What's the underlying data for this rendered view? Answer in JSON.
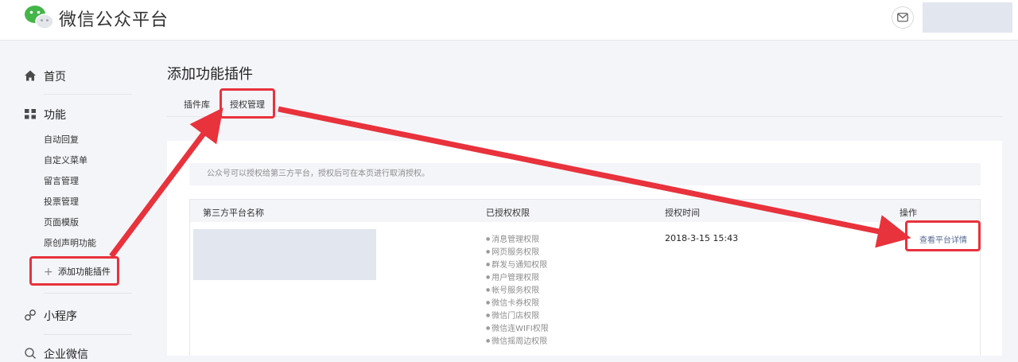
{
  "header": {
    "brand": "微信公众平台"
  },
  "sidebar": {
    "home": "首页",
    "feature": "功能",
    "feature_items": [
      "自动回复",
      "自定义菜单",
      "留言管理",
      "投票管理",
      "页面模版",
      "原创声明功能"
    ],
    "add_plugin": "添加功能插件",
    "mini_program": "小程序",
    "enterprise_wechat": "企业微信"
  },
  "main": {
    "title": "添加功能插件",
    "tabs": [
      "插件库",
      "授权管理"
    ],
    "notice": "公众号可以授权给第三方平台，授权后可在本页进行取消授权。",
    "table": {
      "headers": [
        "第三方平台名称",
        "已授权权限",
        "授权时间",
        "操作"
      ],
      "rows": [
        {
          "permissions": [
            "消息管理权限",
            "网页服务权限",
            "群发与通知权限",
            "用户管理权限",
            "帐号服务权限",
            "微信卡券权限",
            "微信门店权限",
            "微信连WIFI权限",
            "微信摇周边权限"
          ],
          "time": "2018-3-15 15:43",
          "action": "查看平台详情"
        }
      ]
    }
  },
  "colors": {
    "accent_green": "#44b549",
    "link_blue": "#576b95",
    "annotation_red": "#e8323c"
  }
}
